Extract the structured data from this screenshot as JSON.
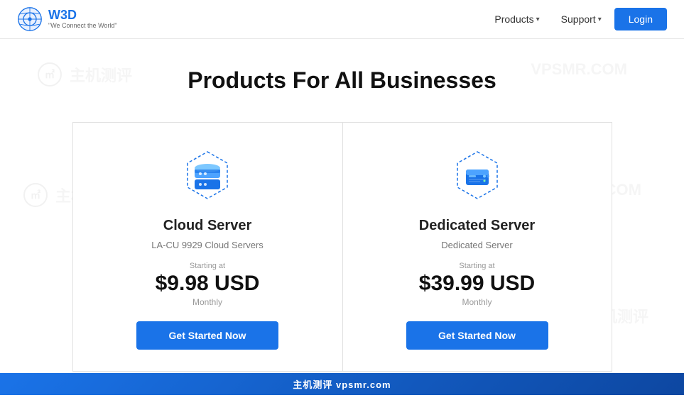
{
  "nav": {
    "logo": {
      "text": "W3D",
      "tagline": "\"We Connect the World\""
    },
    "links": [
      {
        "label": "Products",
        "has_dropdown": true
      },
      {
        "label": "Support",
        "has_dropdown": true
      }
    ],
    "login_label": "Login"
  },
  "main": {
    "section_title": "Products For All Businesses",
    "cards": [
      {
        "id": "cloud-server",
        "title": "Cloud Server",
        "subtitle": "LA-CU 9929 Cloud Servers",
        "starting_at": "Starting at",
        "price": "$9.98 USD",
        "period": "Monthly",
        "cta": "Get Started Now"
      },
      {
        "id": "dedicated-server",
        "title": "Dedicated Server",
        "subtitle": "Dedicated Server",
        "starting_at": "Starting at",
        "price": "$39.99 USD",
        "period": "Monthly",
        "cta": "Get Started Now"
      }
    ]
  },
  "watermarks": [
    {
      "text": "VPSMR.COM"
    },
    {
      "text": "主机测评"
    }
  ],
  "bottom_bar": "主机测评  vpsmr.com"
}
